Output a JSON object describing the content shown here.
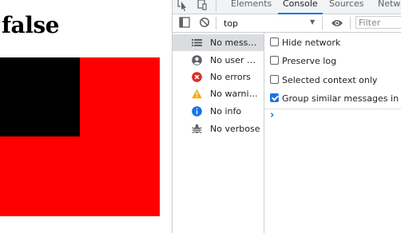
{
  "page": {
    "heading": "false"
  },
  "devtools": {
    "tabs": [
      "Elements",
      "Console",
      "Sources",
      "Network"
    ],
    "active_tab": "Console",
    "toolbar": {
      "context": "top",
      "filter_placeholder": "Filter"
    },
    "sidebar": [
      {
        "label": "No messages",
        "icon": "list-icon",
        "color": "#5f6368"
      },
      {
        "label": "No user me...",
        "icon": "user-icon",
        "color": "#5f6368"
      },
      {
        "label": "No errors",
        "icon": "error-icon",
        "color": "#d93025"
      },
      {
        "label": "No warnings",
        "icon": "warning-icon",
        "color": "#f9ab00"
      },
      {
        "label": "No info",
        "icon": "info-icon",
        "color": "#1a73e8"
      },
      {
        "label": "No verbose",
        "icon": "bug-icon",
        "color": "#5f6368"
      }
    ],
    "settings": [
      {
        "label": "Hide network",
        "checked": false
      },
      {
        "label": "Preserve log",
        "checked": false
      },
      {
        "label": "Selected context only",
        "checked": false
      },
      {
        "label": "Group similar messages in console",
        "checked": true
      }
    ],
    "prompt": "›"
  },
  "colors": {
    "red_box": "#ff0000",
    "black_box": "#000000",
    "accent": "#1a73e8"
  }
}
